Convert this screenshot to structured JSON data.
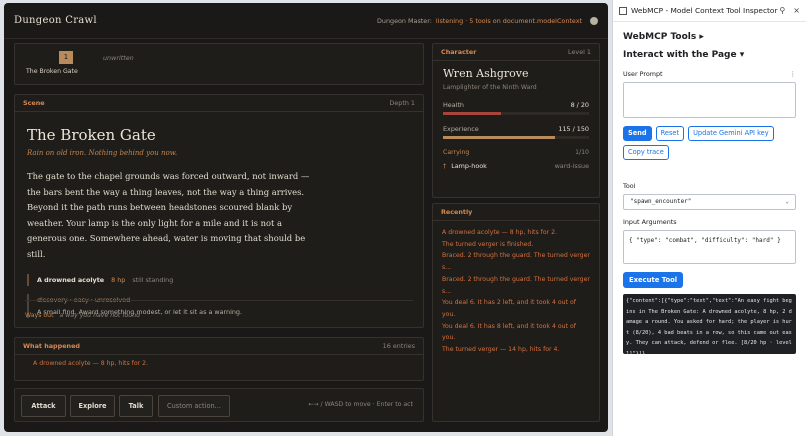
{
  "game": {
    "title": "Dungeon Crawl",
    "dm_label": "Dungeon Master:",
    "dm_status": "listening · 5 tools on document.modelContext"
  },
  "map": {
    "node_number": "1",
    "node_name": "The Broken Gate",
    "unwritten": "unwritten"
  },
  "scene": {
    "header": "Scene",
    "depth": "Depth 1",
    "title": "The Broken Gate",
    "subtitle": "Rain on old iron. Nothing behind you now.",
    "text": "The gate to the chapel grounds was forced outward, not inward — the bars bent the way a thing leaves, not the way a thing arrives. Beyond it the path runs between headstones scoured blank by weather. Your lamp is the only light for a mile and it is not a generous one. Somewhere ahead, water is moving that should be still.",
    "enemy": {
      "name": "A drowned acolyte",
      "hp": "8 hp",
      "status": "still standing"
    },
    "discovery": {
      "meta": "discovery · easy · unresolved",
      "desc": "A small find. Award something modest, or let it sit as a warning."
    },
    "ways_out_label": "Ways out",
    "ways_out_value": "a way you have not found"
  },
  "history": {
    "header": "What happened",
    "count": "16 entries",
    "entry": "A drowned acolyte — 8 hp, hits for 2."
  },
  "actions": {
    "attack": "Attack",
    "explore": "Explore",
    "talk": "Talk",
    "custom": "Custom action...",
    "hint": "←→ / WASD to move · Enter to act"
  },
  "character": {
    "header": "Character",
    "level": "Level 1",
    "name": "Wren Ashgrove",
    "title": "Lamplighter of the Ninth Ward",
    "health_label": "Health",
    "health_value": "8 / 20",
    "health_fraction": 0.4,
    "exp_label": "Experience",
    "exp_value": "115 / 150",
    "exp_fraction": 0.77,
    "carrying_label": "Carrying",
    "carrying_value": "1/10",
    "item_glyph": "†",
    "item_name": "Lamp-hook",
    "item_tag": "ward-issue",
    "health_color": "#a8453a",
    "exp_color": "#b98a5c"
  },
  "recent": {
    "header": "Recently",
    "entries": [
      "A drowned acolyte — 8 hp, hits for 2.",
      "The turned verger is finished.",
      "Braced. 2 through the guard. The turned verger s...",
      "Braced. 2 through the guard. The turned verger s...",
      "You deal 6. It has 2 left, and it took 4 out of you.",
      "You deal 6. It has 8 left, and it took 4 out of you.",
      "The turned verger — 14 hp, hits for 4."
    ]
  },
  "inspector": {
    "title": "WebMCP - Model Context Tool Inspector",
    "tools_heading": "WebMCP Tools ▸",
    "interact_heading": "Interact with the Page ▾",
    "prompt_label": "User Prompt",
    "send": "Send",
    "reset": "Reset",
    "update_key": "Update Gemini API key",
    "copy_trace": "Copy trace",
    "tool_label": "Tool",
    "tool_value": "\"spawn_encounter\"",
    "args_label": "Input Arguments",
    "args_value": "{ \"type\": \"combat\", \"difficulty\": \"hard\" }",
    "execute": "Execute Tool",
    "output": "{\"content\":[{\"type\":\"text\",\"text\":\"An easy fight begins in The Broken Gate: A drowned acolyte, 8 hp, 2 damage a round. You asked for hard; the player is hurt (8/20), 4 bad beats in a row, so this came out easy. They can attack, defend or flee. [8/20 hp · level 1]\"}]}"
  }
}
